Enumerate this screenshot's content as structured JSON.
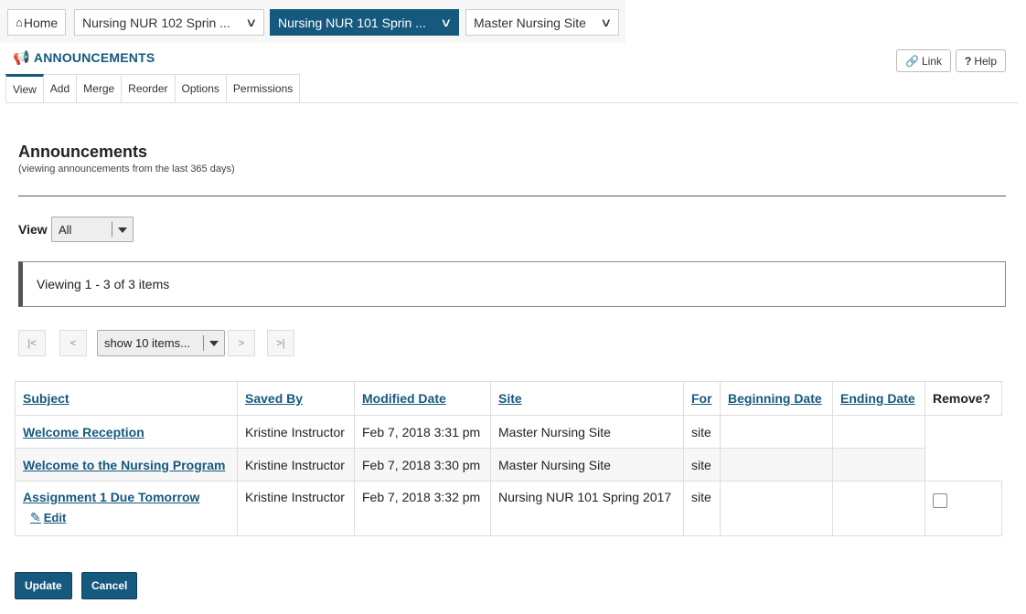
{
  "sitebar": {
    "home_label": "Home",
    "sites": [
      {
        "label": "Nursing NUR 102 Sprin ...",
        "active": false
      },
      {
        "label": "Nursing NUR 101 Sprin ...",
        "active": true
      },
      {
        "label": "Master Nursing Site",
        "active": false
      }
    ]
  },
  "tool": {
    "title": "ANNOUNCEMENTS",
    "link_label": "Link",
    "help_label": "Help",
    "tabs": [
      "View",
      "Add",
      "Merge",
      "Reorder",
      "Options",
      "Permissions"
    ]
  },
  "main": {
    "heading": "Announcements",
    "subnote": "(viewing announcements from the last 365 days)",
    "view_label": "View",
    "view_selected": "All",
    "info_text": "Viewing 1 - 3 of 3 items"
  },
  "pager": {
    "first": "|<",
    "prev": "<",
    "page_size": "show 10 items...",
    "next": ">",
    "last": ">|"
  },
  "table": {
    "headers": [
      "Subject",
      "Saved By",
      "Modified Date",
      "Site",
      "For",
      "Beginning Date",
      "Ending Date",
      "Remove?"
    ],
    "rows": [
      {
        "subject": "Welcome Reception",
        "saved_by": "Kristine Instructor",
        "modified": "Feb 7, 2018 3:31 pm",
        "site": "Master Nursing Site",
        "for": "site",
        "begin": "",
        "end": ""
      },
      {
        "subject": "Welcome to the Nursing Program",
        "saved_by": "Kristine Instructor",
        "modified": "Feb 7, 2018 3:30 pm",
        "site": "Master Nursing Site",
        "for": "site",
        "begin": "",
        "end": ""
      },
      {
        "subject": "Assignment 1 Due Tomorrow",
        "edit": "Edit",
        "saved_by": "Kristine Instructor",
        "modified": "Feb 7, 2018 3:32 pm",
        "site": "Nursing NUR 101 Spring 2017",
        "for": "site",
        "begin": "",
        "end": ""
      }
    ]
  },
  "actions": {
    "update": "Update",
    "cancel": "Cancel"
  },
  "colors": {
    "accent": "#15597e"
  }
}
